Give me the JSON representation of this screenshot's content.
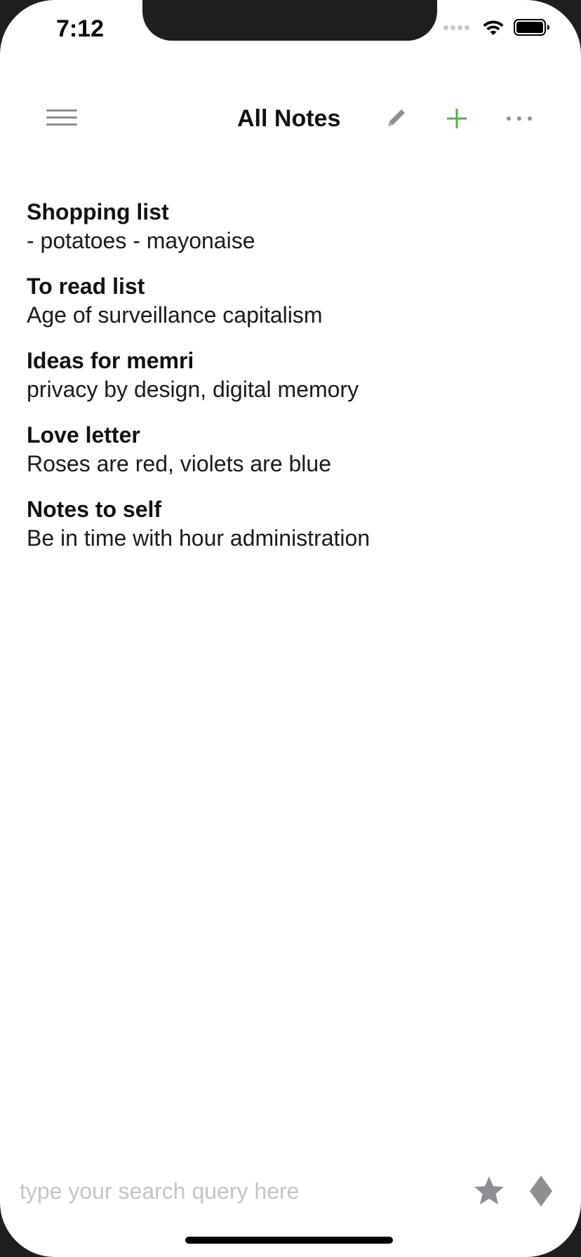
{
  "status_bar": {
    "time": "7:12"
  },
  "header": {
    "title": "All Notes",
    "icons": {
      "menu": "hamburger-menu-icon",
      "edit": "pencil-icon",
      "add": "plus-icon",
      "more": "ellipsis-icon"
    },
    "accent_color": "#4cb648",
    "icon_color": "#8e8e93"
  },
  "notes": [
    {
      "title": "Shopping list",
      "body": "- potatoes - mayonaise"
    },
    {
      "title": "To read list",
      "body": "Age of surveillance capitalism"
    },
    {
      "title": "Ideas for memri",
      "body": "privacy by design, digital memory"
    },
    {
      "title": "Love letter",
      "body": "Roses are red, violets are blue"
    },
    {
      "title": "Notes to self",
      "body": "Be in time with hour administration"
    }
  ],
  "search": {
    "placeholder": "type your search query here",
    "value": ""
  },
  "bottom_icons": {
    "favorite": "star-icon",
    "filter": "diamond-icon"
  }
}
